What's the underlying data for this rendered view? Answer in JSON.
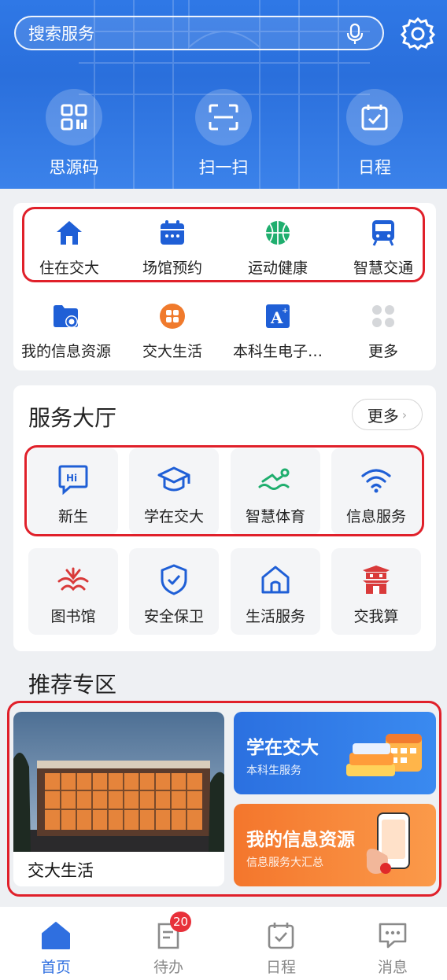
{
  "header": {
    "search_placeholder": "搜索服务",
    "quick_actions": [
      {
        "label": "思源码",
        "icon": "qr-code-icon"
      },
      {
        "label": "扫一扫",
        "icon": "scan-icon"
      },
      {
        "label": "日程",
        "icon": "calendar-check-icon"
      }
    ]
  },
  "top_grid": {
    "row1": [
      {
        "label": "住在交大",
        "icon": "house-icon"
      },
      {
        "label": "场馆预约",
        "icon": "calendar-icon"
      },
      {
        "label": "运动健康",
        "icon": "basketball-icon"
      },
      {
        "label": "智慧交通",
        "icon": "bus-icon"
      }
    ],
    "row2": [
      {
        "label": "我的信息资源",
        "icon": "folder-gear-icon"
      },
      {
        "label": "交大生活",
        "icon": "grid-circle-icon"
      },
      {
        "label": "本科生电子…",
        "icon": "font-a-plus-icon"
      },
      {
        "label": "更多",
        "icon": "dots-grid-icon"
      }
    ]
  },
  "service_hall": {
    "title": "服务大厅",
    "more_label": "更多",
    "row1": [
      {
        "label": "新生",
        "icon": "hi-chat-icon"
      },
      {
        "label": "学在交大",
        "icon": "graduation-cap-icon"
      },
      {
        "label": "智慧体育",
        "icon": "swimmer-icon"
      },
      {
        "label": "信息服务",
        "icon": "wifi-icon"
      }
    ],
    "row2": [
      {
        "label": "图书馆",
        "icon": "library-logo-icon"
      },
      {
        "label": "安全保卫",
        "icon": "shield-check-icon"
      },
      {
        "label": "生活服务",
        "icon": "home-outline-icon"
      },
      {
        "label": "交我算",
        "icon": "pagoda-icon"
      }
    ]
  },
  "recommend": {
    "title": "推荐专区",
    "left_caption": "交大生活",
    "cards": [
      {
        "title": "学在交大",
        "subtitle": "本科生服务",
        "color": "#2f7ae8"
      },
      {
        "title": "我的信息资源",
        "subtitle": "信息服务大汇总",
        "color": "#f57a2c"
      }
    ]
  },
  "nav": {
    "items": [
      {
        "label": "首页",
        "icon": "home-icon",
        "active": true
      },
      {
        "label": "待办",
        "icon": "todo-icon",
        "badge": "20"
      },
      {
        "label": "日程",
        "icon": "schedule-icon"
      },
      {
        "label": "消息",
        "icon": "message-icon"
      }
    ]
  },
  "colors": {
    "accent": "#2f6fe0",
    "highlight_border": "#e0202a",
    "badge": "#e8303a"
  }
}
